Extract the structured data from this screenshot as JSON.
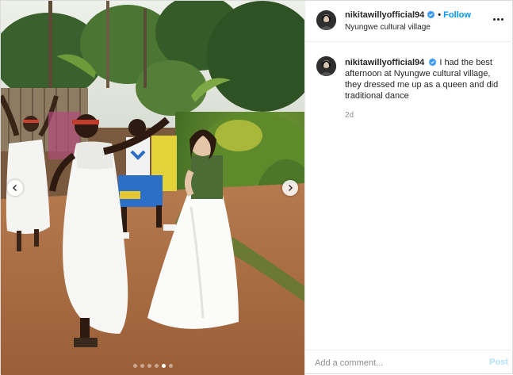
{
  "post": {
    "username": "nikitawillyofficial94",
    "verified": true,
    "follow_label": "Follow",
    "separator": "•",
    "location": "Nyungwe cultural village",
    "caption": "I had the best afternoon at Nyungwe cultural village, they dressed me up as a queen and did traditional dance",
    "age": "2d",
    "comment_placeholder": "Add a comment...",
    "post_label": "Post"
  },
  "carousel": {
    "slide_count": 6,
    "active_index": 4,
    "prev_icon": "chevron-left-icon",
    "next_icon": "chevron-right-icon"
  },
  "colors": {
    "accent": "#0095f6",
    "post_disabled": "#b2dffc",
    "verified": "#3897f0",
    "text": "#262626",
    "muted": "#8e8e8e"
  }
}
